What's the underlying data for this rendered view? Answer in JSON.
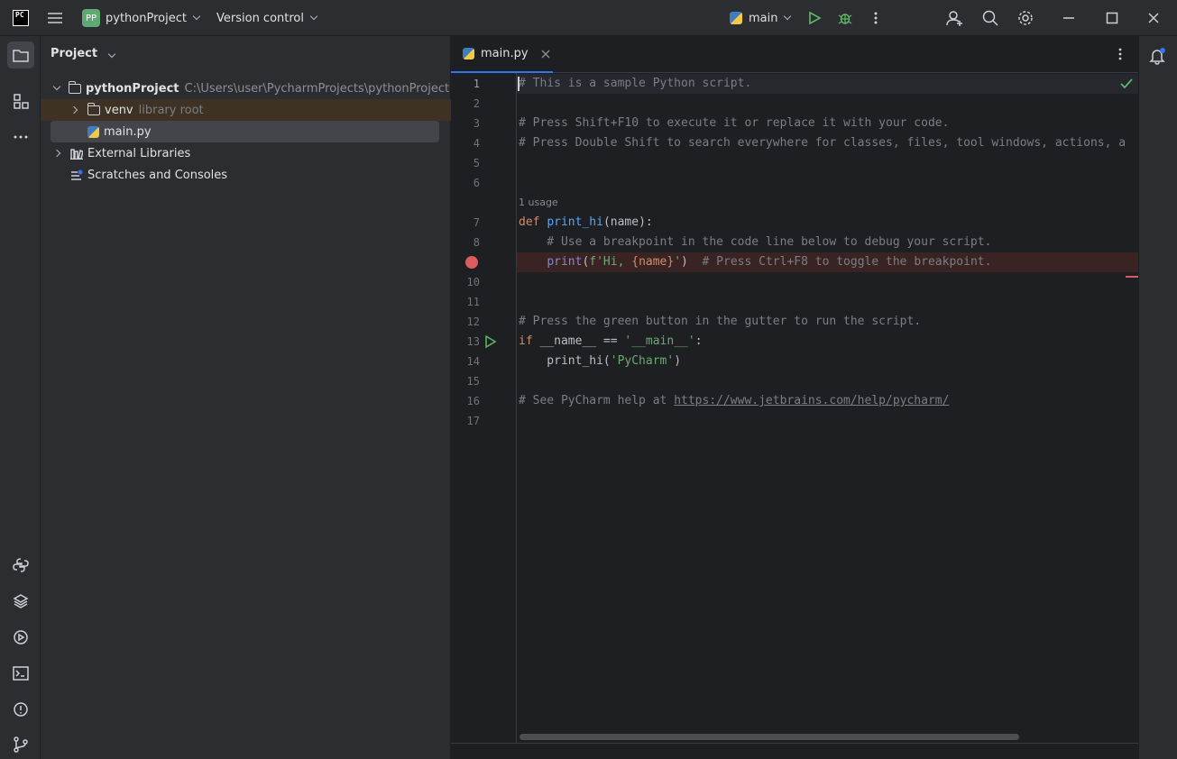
{
  "titlebar": {
    "app_logo": "PC",
    "project_badge": "PP",
    "project_name": "pythonProject",
    "vcs_label": "Version control",
    "run_config": "main"
  },
  "project_panel": {
    "title": "Project",
    "tree": [
      {
        "label": "pythonProject",
        "path": "C:\\Users\\user\\PycharmProjects\\pythonProject"
      },
      {
        "label": "venv",
        "note": "library root"
      },
      {
        "label": "main.py"
      },
      {
        "label": "External Libraries"
      },
      {
        "label": "Scratches and Consoles"
      }
    ]
  },
  "editor": {
    "tab_label": "main.py",
    "usage_hint": "1 usage",
    "line_numbers": [
      "1",
      "2",
      "3",
      "4",
      "5",
      "6",
      "7",
      "8",
      "9",
      "10",
      "11",
      "12",
      "13",
      "14",
      "15",
      "16",
      "17"
    ],
    "lines": {
      "l1": "# This is a sample Python script.",
      "l3": "# Press Shift+F10 to execute it or replace it with your code.",
      "l4": "# Press Double Shift to search everywhere for classes, files, tool windows, actions, a",
      "l7_kw": "def",
      "l7_fn": "print_hi",
      "l7_rest": "(name):",
      "l8": "    # Use a breakpoint in the code line below to debug your script.",
      "l9_fn": "print",
      "l9_str1": "f'Hi, ",
      "l9_expr": "{name}",
      "l9_str2": "'",
      "l9_cm": "  # Press Ctrl+F8 to toggle the breakpoint.",
      "l12": "# Press the green button in the gutter to run the script.",
      "l13_kw": "if",
      "l13_mid": " __name__ == ",
      "l13_str": "'__main__'",
      "l13_end": ":",
      "l14_call": "    print_hi(",
      "l14_str": "'PyCharm'",
      "l14_end": ")",
      "l16_cm": "# See PyCharm help at ",
      "l16_link": "https://www.jetbrains.com/help/pycharm/"
    }
  },
  "colors": {
    "accent": "#3574f0",
    "breakpoint": "#db5c5c",
    "run_green": "#5fb865"
  }
}
